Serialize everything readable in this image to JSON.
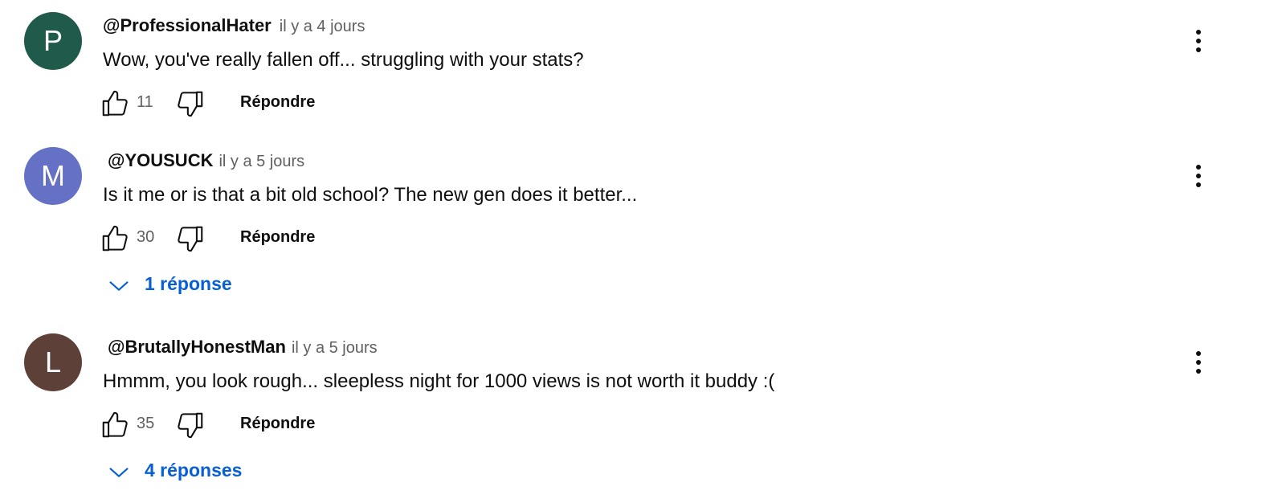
{
  "colors": {
    "link_blue": "#065fd4",
    "meta_gray": "#606060"
  },
  "icons": {
    "like": "thumbs-up-icon",
    "dislike": "thumbs-down-icon",
    "more": "more-vertical-icon",
    "expand": "chevron-down-icon"
  },
  "comments": [
    {
      "avatar_letter": "P",
      "avatar_color": "#1f5a4a",
      "author": "@ProfessionalHater",
      "time": "il y a 4 jours",
      "text": "Wow, you've really fallen off... struggling with your stats?",
      "likes": "11",
      "reply_label": "Répondre"
    },
    {
      "avatar_letter": "M",
      "avatar_color": "#6471c5",
      "author": "@YOUSUCK",
      "time": "il y a 5 jours",
      "text": "Is it me or is that a bit old school? The new gen does it better...",
      "likes": "30",
      "reply_label": "Répondre",
      "replies_label": "1 réponse"
    },
    {
      "avatar_letter": "L",
      "avatar_color": "#5d4037",
      "author": "@BrutallyHonestMan",
      "time": "il y a 5 jours",
      "text": "Hmmm, you look rough... sleepless night for 1000 views is not worth it buddy :(",
      "likes": "35",
      "reply_label": "Répondre",
      "replies_label": "4 réponses"
    }
  ]
}
